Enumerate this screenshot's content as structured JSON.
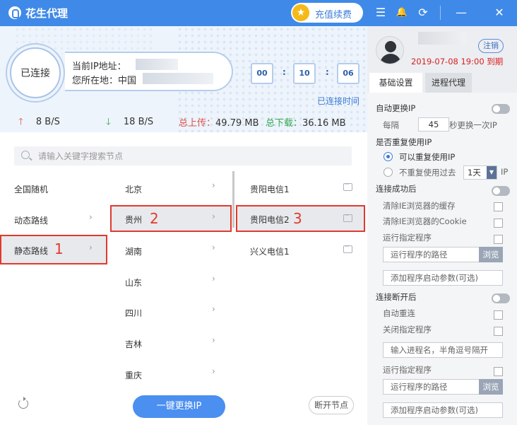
{
  "titlebar": {
    "app_name": "花生代理",
    "recharge_label": "充值续费",
    "menu_icon": "☰",
    "bell_icon": "🔔",
    "support_icon": "⟳",
    "minimize_icon": "—",
    "close_icon": "✕"
  },
  "status": {
    "connected_label": "已连接",
    "ip_label": "当前IP地址：",
    "location_label": "您所在地：中国",
    "timer": [
      "00",
      "10",
      "06"
    ],
    "connected_time_label": "已连接时间",
    "upload_speed": "8 B/S",
    "download_speed": "18 B/S",
    "total_upload_label": "总上传：",
    "total_upload_value": "49.79 MB",
    "total_download_label": "总下载：",
    "total_download_value": "36.16 MB"
  },
  "search": {
    "placeholder": "请输入关键字搜索节点"
  },
  "columns": {
    "categories": [
      "全国随机",
      "动态路线",
      "静态路线"
    ],
    "provinces": [
      "北京",
      "贵州",
      "湖南",
      "山东",
      "四川",
      "吉林",
      "重庆"
    ],
    "nodes": [
      "贵阳电信1",
      "贵阳电信2",
      "兴义电信1"
    ]
  },
  "markers": [
    "1",
    "2",
    "3"
  ],
  "bottom": {
    "switch_ip_label": "一键更换IP",
    "disconnect_label": "断开节点"
  },
  "account": {
    "logout_label": "注销",
    "expiry": "2019-07-08 19:00 到期"
  },
  "tabs": [
    "基础设置",
    "进程代理"
  ],
  "settings": {
    "auto_switch_ip": "自动更换IP",
    "every_label": "每隔",
    "interval_value": "45",
    "interval_suffix": "秒更换一次IP",
    "reuse_ip_label": "是否重复使用IP",
    "reuse_yes": "可以重复使用IP",
    "reuse_no": "不重复使用过去",
    "days_value": "1天",
    "ip_suffix": "IP",
    "on_connect_label": "连接成功后",
    "clear_ie_cache": "清除IE浏览器的缓存",
    "clear_ie_cookie": "清除IE浏览器的Cookie",
    "run_program_1": "运行指定程序",
    "program_path_placeholder_1": "运行程序的路径",
    "browse_1": "浏览",
    "program_args_1": "添加程序启动参数(可选)",
    "on_disconnect_label": "连接断开后",
    "auto_reconnect": "自动重连",
    "close_program": "关闭指定程序",
    "process_name_placeholder": "输入进程名，半角逗号隔开",
    "run_program_2": "运行指定程序",
    "program_path_placeholder_2": "运行程序的路径",
    "browse_2": "浏览",
    "program_args_2": "添加程序启动参数(可选)"
  },
  "colors": {
    "titlebar": "#3f8ae8",
    "accent": "#4b8ff0",
    "highlight_border": "#e03a2e",
    "expiry_text": "#d92020"
  }
}
